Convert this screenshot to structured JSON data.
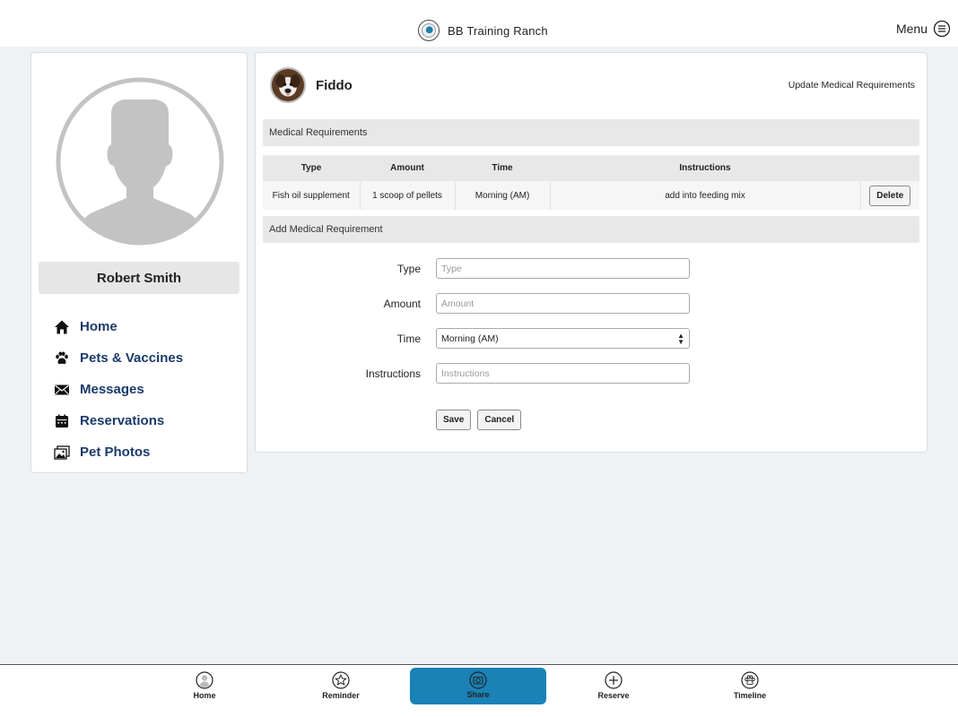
{
  "header": {
    "brand_name": "BB Training Ranch",
    "menu_label": "Menu"
  },
  "profile": {
    "name": "Robert Smith"
  },
  "sidebar": {
    "items": [
      {
        "label": "Home",
        "icon": "home-icon"
      },
      {
        "label": "Pets & Vaccines",
        "icon": "paw-icon"
      },
      {
        "label": "Messages",
        "icon": "envelope-icon"
      },
      {
        "label": "Reservations",
        "icon": "calendar-icon"
      },
      {
        "label": "Pet Photos",
        "icon": "photos-icon"
      }
    ]
  },
  "pet": {
    "name": "Fiddo",
    "update_link": "Update Medical Requirements"
  },
  "medical": {
    "section_title": "Medical Requirements",
    "columns": [
      "Type",
      "Amount",
      "Time",
      "Instructions"
    ],
    "rows": [
      {
        "type": "Fish oil supplement",
        "amount": "1 scoop of pellets",
        "time": "Morning (AM)",
        "instructions": "add into feeding mix",
        "action": "Delete"
      }
    ]
  },
  "add_form": {
    "section_title": "Add Medical Requirement",
    "type_label": "Type",
    "type_placeholder": "Type",
    "amount_label": "Amount",
    "amount_placeholder": "Amount",
    "time_label": "Time",
    "time_value": "Morning (AM)",
    "instructions_label": "Instructions",
    "instructions_placeholder": "Instructions",
    "save_label": "Save",
    "cancel_label": "Cancel"
  },
  "bottom_nav": {
    "tabs": [
      {
        "label": "Home",
        "icon": "user-circle-icon"
      },
      {
        "label": "Reminder",
        "icon": "star-icon"
      },
      {
        "label": "Share",
        "icon": "camera-icon"
      },
      {
        "label": "Reserve",
        "icon": "plus-circle-icon"
      },
      {
        "label": "Timeline",
        "icon": "paw-circle-icon"
      }
    ],
    "active": "Share"
  },
  "colors": {
    "accent": "#1a82b7",
    "nav_text": "#1b3a6b",
    "page_bg": "#eff2f5",
    "section_bg": "#e8e8e8"
  }
}
